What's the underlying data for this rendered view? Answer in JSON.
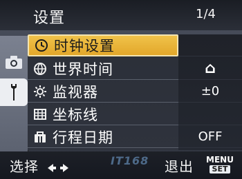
{
  "header": {
    "title": "设置",
    "page_indicator": "1/4"
  },
  "menu": {
    "items": [
      {
        "label": "时钟设置",
        "icon": "clock-icon",
        "value": ""
      },
      {
        "label": "世界时间",
        "icon": "globe-icon",
        "value": "⌂"
      },
      {
        "label": "监视器",
        "icon": "brightness-icon",
        "value": "±0"
      },
      {
        "label": "坐标线",
        "icon": "grid-icon",
        "value": ""
      },
      {
        "label": "行程日期",
        "icon": "suitcase-icon",
        "value": "OFF"
      }
    ],
    "selected_index": 0
  },
  "left_tabs": [
    {
      "icon": "camera-icon"
    },
    {
      "icon": "wrench-icon"
    }
  ],
  "footer": {
    "select_label": "选择",
    "select_icon": "left-right-arrow-icon",
    "exit_label": "退出",
    "menu_set_top": "MENU",
    "menu_set_bottom": "SET"
  },
  "watermark": "IT168",
  "colors": {
    "highlight": "#f0c24a",
    "menu_bg": "#2b2f38",
    "text": "#ffffff"
  }
}
